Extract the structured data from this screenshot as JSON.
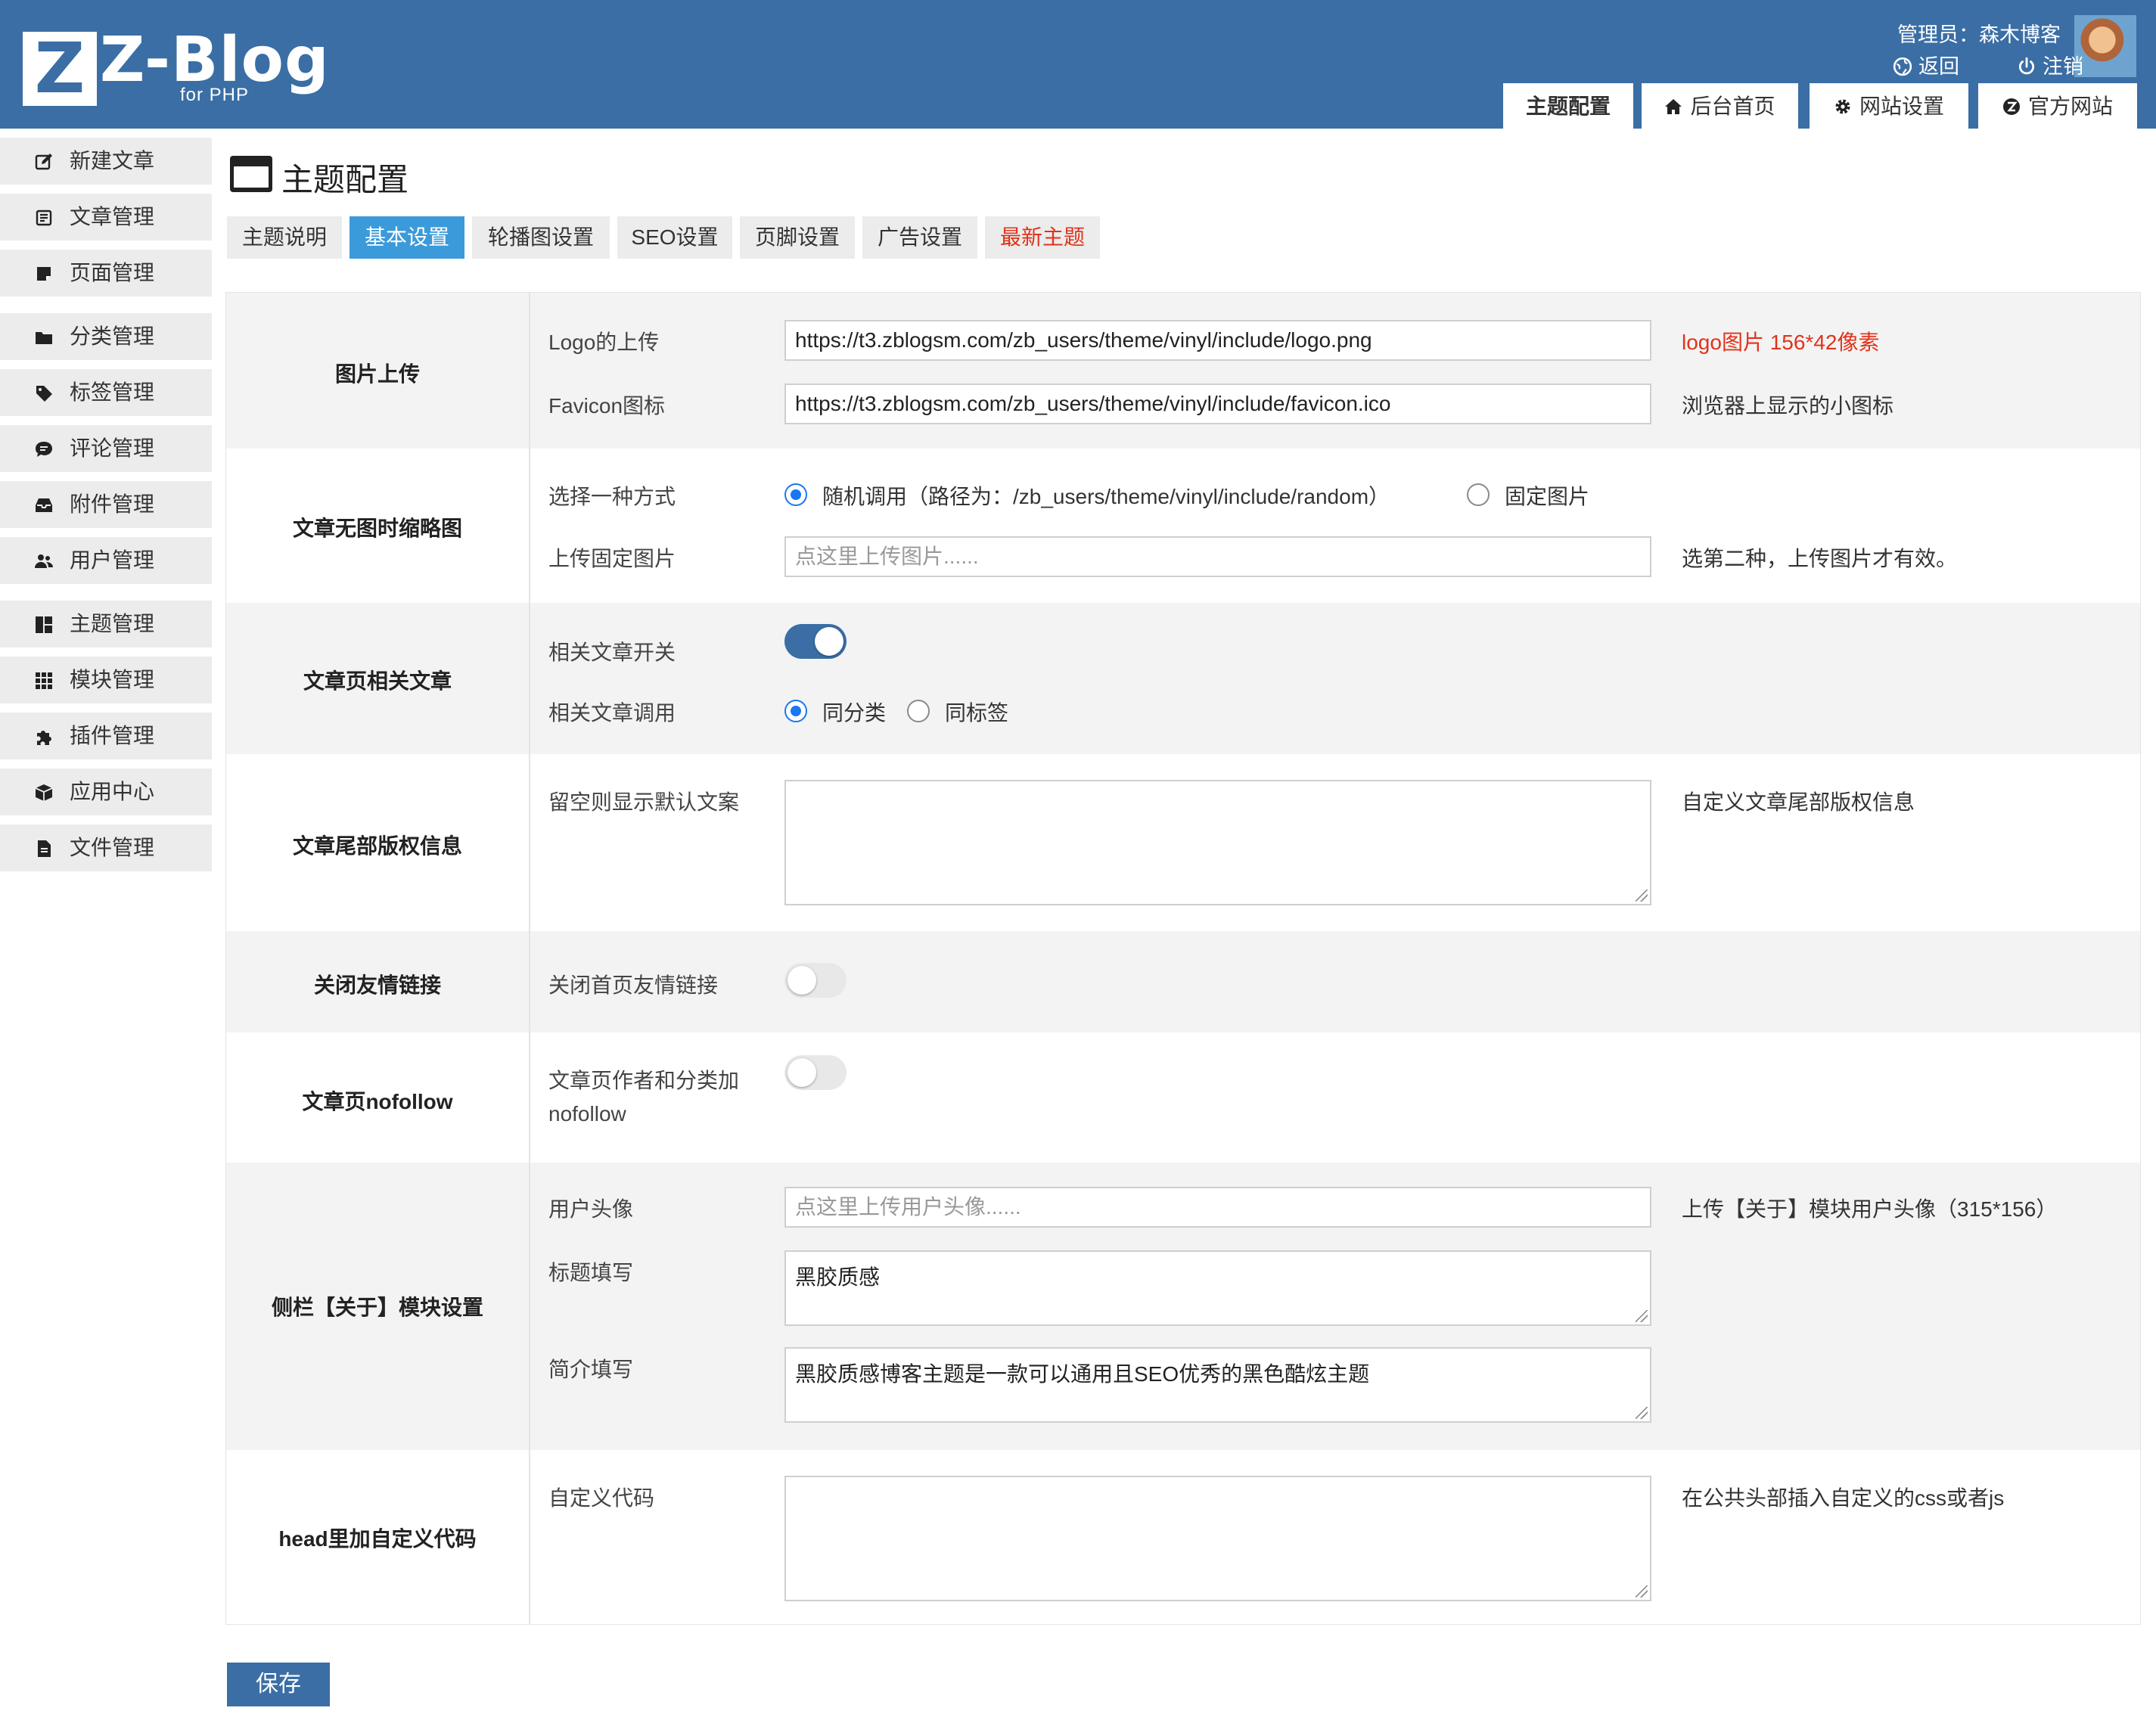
{
  "brand": {
    "logo_letter": "Z",
    "name": "Z-Blog",
    "sub": "for PHP"
  },
  "header": {
    "admin_label": "管理员：森木博客",
    "back_label": "返回",
    "logout_label": "注销",
    "tabs": [
      {
        "label": "主题配置",
        "active": true
      },
      {
        "label": "后台首页",
        "icon": "home-icon"
      },
      {
        "label": "网站设置",
        "icon": "gear-icon"
      },
      {
        "label": "官方网站",
        "icon": "zblog-icon"
      }
    ]
  },
  "sidebar": {
    "items": [
      {
        "label": "新建文章",
        "icon": "edit-icon"
      },
      {
        "label": "文章管理",
        "icon": "article-icon"
      },
      {
        "label": "页面管理",
        "icon": "page-icon"
      },
      {
        "label": "分类管理",
        "icon": "folder-icon"
      },
      {
        "label": "标签管理",
        "icon": "tag-icon"
      },
      {
        "label": "评论管理",
        "icon": "comment-icon"
      },
      {
        "label": "附件管理",
        "icon": "inbox-icon"
      },
      {
        "label": "用户管理",
        "icon": "users-icon"
      },
      {
        "label": "主题管理",
        "icon": "layout-icon"
      },
      {
        "label": "模块管理",
        "icon": "grid-icon"
      },
      {
        "label": "插件管理",
        "icon": "puzzle-icon"
      },
      {
        "label": "应用中心",
        "icon": "box-icon"
      },
      {
        "label": "文件管理",
        "icon": "file-icon"
      }
    ]
  },
  "page": {
    "title": "主题配置",
    "tabs": [
      {
        "label": "主题说明"
      },
      {
        "label": "基本设置",
        "active": true
      },
      {
        "label": "轮播图设置"
      },
      {
        "label": "SEO设置"
      },
      {
        "label": "页脚设置"
      },
      {
        "label": "广告设置"
      },
      {
        "label": "最新主题",
        "highlight": true
      }
    ]
  },
  "settings": {
    "image_upload": {
      "section": "图片上传",
      "logo_label": "Logo的上传",
      "logo_value": "https://t3.zblogsm.com/zb_users/theme/vinyl/include/logo.png",
      "logo_hint": "logo图片 156*42像素",
      "favicon_label": "Favicon图标",
      "favicon_value": "https://t3.zblogsm.com/zb_users/theme/vinyl/include/favicon.ico",
      "favicon_hint": "浏览器上显示的小图标"
    },
    "thumbnail": {
      "section": "文章无图时缩略图",
      "mode_label": "选择一种方式",
      "option_random": "随机调用（路径为：/zb_users/theme/vinyl/include/random）",
      "option_fixed": "固定图片",
      "selected": "random",
      "upload_label": "上传固定图片",
      "upload_placeholder": "点这里上传图片......",
      "upload_hint": "选第二种，上传图片才有效。"
    },
    "related": {
      "section": "文章页相关文章",
      "switch_label": "相关文章开关",
      "switch_on": true,
      "call_label": "相关文章调用",
      "option_category": "同分类",
      "option_tag": "同标签",
      "selected": "category"
    },
    "copyright": {
      "section": "文章尾部版权信息",
      "field_label": "留空则显示默认文案",
      "value": "",
      "hint": "自定义文章尾部版权信息"
    },
    "friend_links": {
      "section": "关闭友情链接",
      "field_label": "关闭首页友情链接",
      "switch_on": false
    },
    "nofollow": {
      "section": "文章页nofollow",
      "field_label_line1": "文章页作者和分类加",
      "field_label_line2": "nofollow",
      "switch_on": false
    },
    "about": {
      "section": "侧栏【关于】模块设置",
      "avatar_label": "用户头像",
      "avatar_placeholder": "点这里上传用户头像......",
      "avatar_hint": "上传【关于】模块用户头像（315*156）",
      "title_label": "标题填写",
      "title_value": "黑胶质感",
      "intro_label": "简介填写",
      "intro_value": "黑胶质感博客主题是一款可以通用且SEO优秀的黑色酷炫主题"
    },
    "head_code": {
      "section": "head里加自定义代码",
      "field_label": "自定义代码",
      "value": "",
      "hint": "在公共头部插入自定义的css或者js"
    }
  },
  "actions": {
    "save_label": "保存"
  },
  "colors": {
    "header_bg": "#3a6ea5",
    "active_tab": "#3b9ad9",
    "highlight": "#e0331c",
    "radio": "#1877f2"
  }
}
